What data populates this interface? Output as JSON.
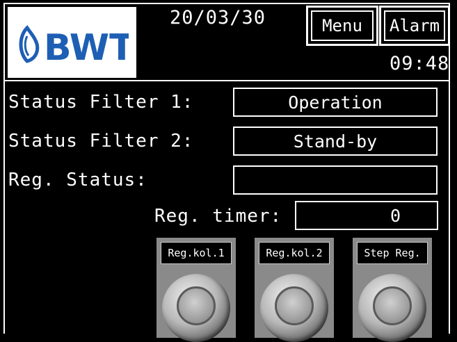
{
  "header": {
    "logo_text": "BWT",
    "date": "20/03/30",
    "time": "09:48",
    "menu_label": "Menu",
    "alarm_label": "Alarm"
  },
  "status": {
    "filter1_label": "Status Filter 1:",
    "filter1_value": "Operation",
    "filter2_label": "Status Filter 2:",
    "filter2_value": "Stand-by",
    "reg_label": "Reg. Status:",
    "reg_value": "",
    "timer_label": "Reg. timer:",
    "timer_value": "0"
  },
  "buttons": [
    {
      "label": "Reg.kol.1"
    },
    {
      "label": "Reg.kol.2"
    },
    {
      "label": "Step Reg."
    }
  ],
  "colors": {
    "logo_blue": "#1e5fb4",
    "background": "#000000",
    "foreground": "#ffffff"
  }
}
